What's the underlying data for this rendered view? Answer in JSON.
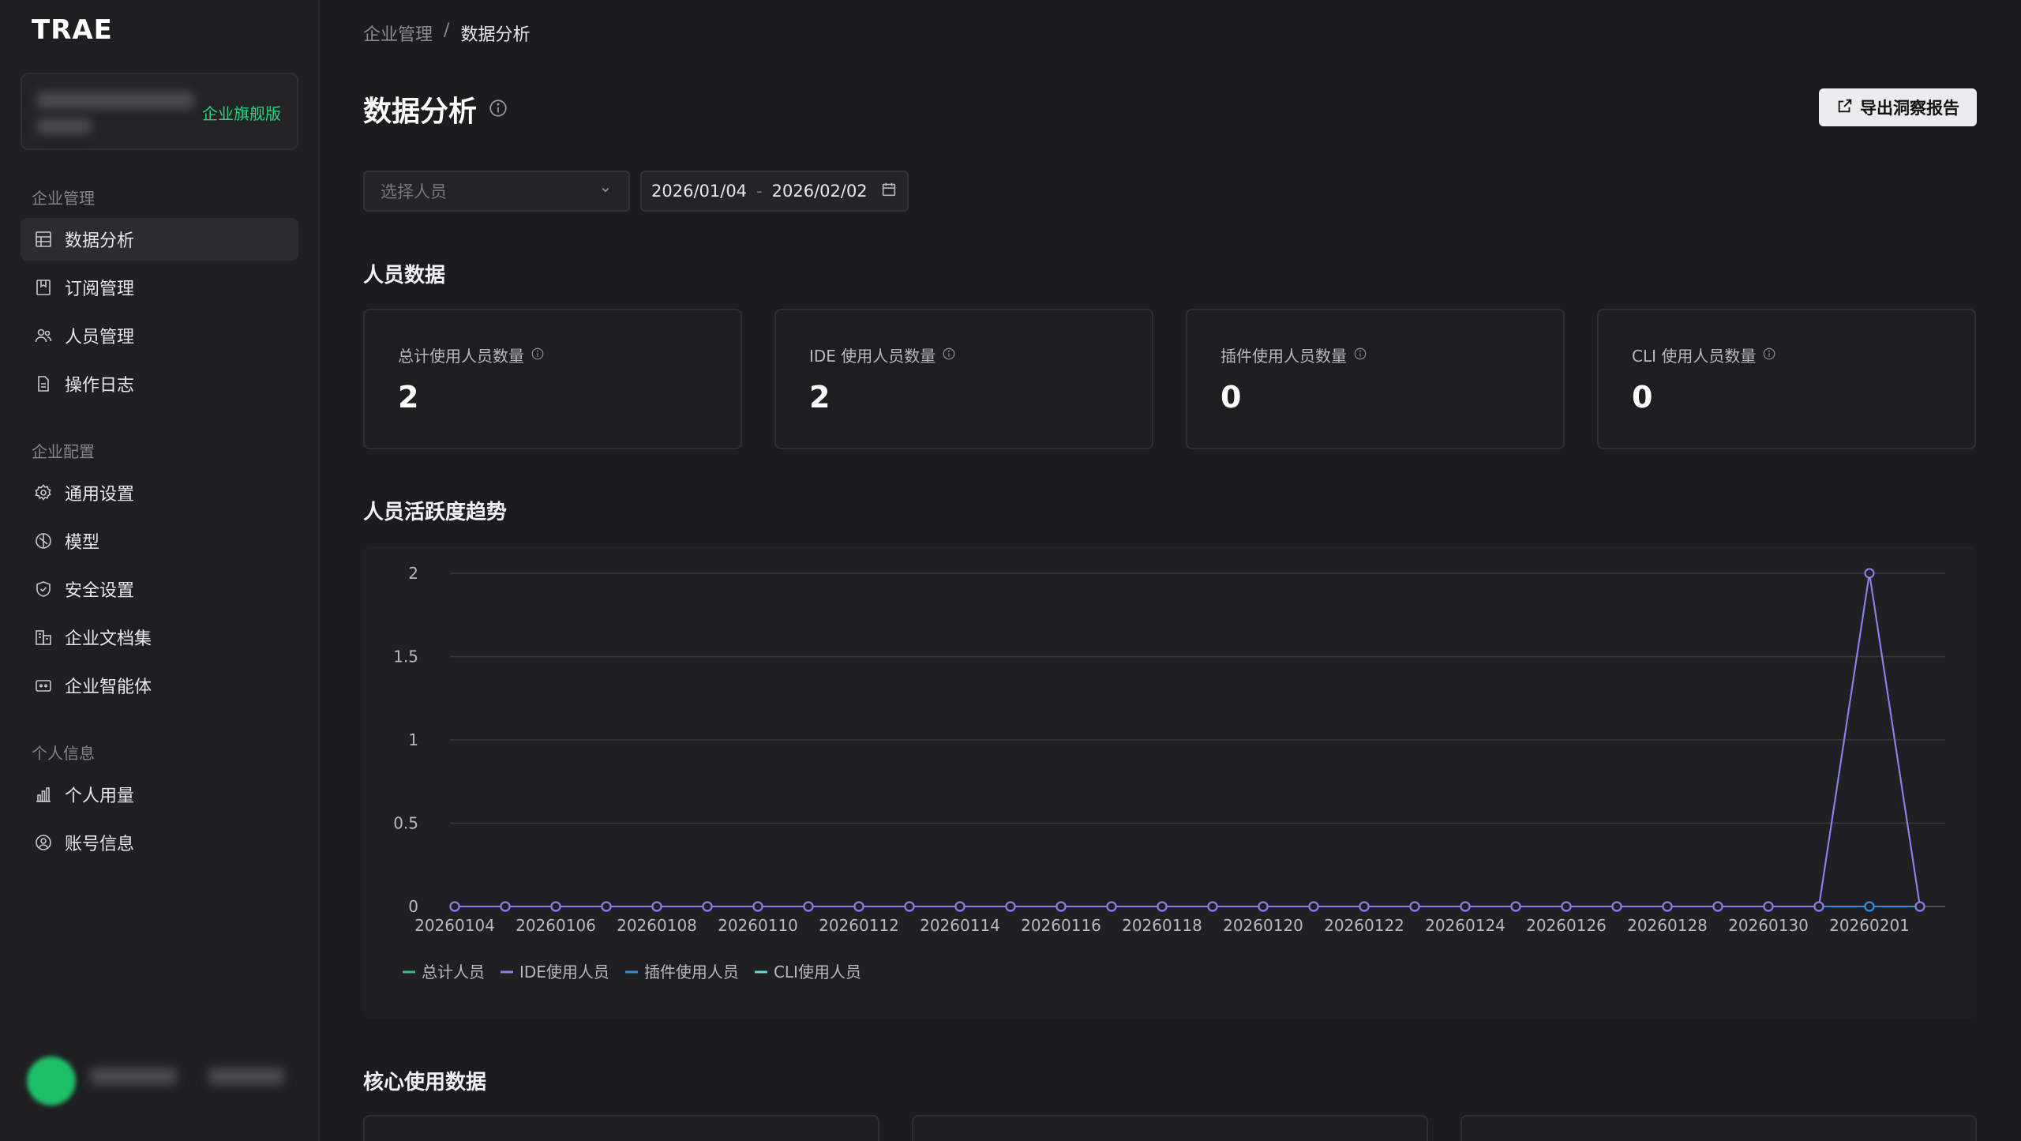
{
  "app": {
    "logo": "TRAE"
  },
  "org": {
    "badge": "企业旗舰版"
  },
  "sidebar": {
    "sections": [
      {
        "label": "企业管理",
        "items": [
          {
            "label": "数据分析",
            "icon": "table-icon",
            "active": true
          },
          {
            "label": "订阅管理",
            "icon": "bookmark-icon"
          },
          {
            "label": "人员管理",
            "icon": "users-icon"
          },
          {
            "label": "操作日志",
            "icon": "file-text-icon"
          }
        ]
      },
      {
        "label": "企业配置",
        "items": [
          {
            "label": "通用设置",
            "icon": "gear-icon"
          },
          {
            "label": "模型",
            "icon": "model-icon"
          },
          {
            "label": "安全设置",
            "icon": "shield-icon"
          },
          {
            "label": "企业文档集",
            "icon": "building-icon"
          },
          {
            "label": "企业智能体",
            "icon": "agent-icon"
          }
        ]
      },
      {
        "label": "个人信息",
        "items": [
          {
            "label": "个人用量",
            "icon": "bar-chart-icon"
          },
          {
            "label": "账号信息",
            "icon": "user-circle-icon"
          }
        ]
      }
    ]
  },
  "breadcrumb": {
    "parent": "企业管理",
    "separator": "/",
    "current": "数据分析"
  },
  "header": {
    "title": "数据分析",
    "export_label": "导出洞察报告"
  },
  "filters": {
    "person_placeholder": "选择人员",
    "date_start": "2026/01/04",
    "date_sep": "-",
    "date_end": "2026/02/02"
  },
  "people_section": {
    "title": "人员数据",
    "stats": [
      {
        "label": "总计使用人员数量",
        "value": "2"
      },
      {
        "label": "IDE 使用人员数量",
        "value": "2"
      },
      {
        "label": "插件使用人员数量",
        "value": "0"
      },
      {
        "label": "CLI 使用人员数量",
        "value": "0"
      }
    ]
  },
  "trend_section": {
    "title": "人员活跃度趋势"
  },
  "core_section": {
    "title": "核心使用数据"
  },
  "colors": {
    "total": "#2ec48a",
    "ide": "#8e7cf0",
    "plugin": "#2f8fe0",
    "cli": "#5fe0d6"
  },
  "chart_data": {
    "type": "line",
    "x": [
      "20260104",
      "20260105",
      "20260106",
      "20260107",
      "20260108",
      "20260109",
      "20260110",
      "20260111",
      "20260112",
      "20260113",
      "20260114",
      "20260115",
      "20260116",
      "20260117",
      "20260118",
      "20260119",
      "20260120",
      "20260121",
      "20260122",
      "20260123",
      "20260124",
      "20260125",
      "20260126",
      "20260127",
      "20260128",
      "20260129",
      "20260130",
      "20260131",
      "20260201",
      "20260202"
    ],
    "xtick_labels": [
      "20260104",
      "20260106",
      "20260108",
      "20260110",
      "20260112",
      "20260114",
      "20260116",
      "20260118",
      "20260120",
      "20260122",
      "20260124",
      "20260126",
      "20260128",
      "20260130",
      "20260201"
    ],
    "yticks": [
      "0",
      "0.5",
      "1",
      "1.5",
      "2"
    ],
    "ylim": [
      0,
      2
    ],
    "grid": true,
    "legend_position": "bottom-left",
    "series": [
      {
        "name": "总计人员",
        "values": [
          0,
          0,
          0,
          0,
          0,
          0,
          0,
          0,
          0,
          0,
          0,
          0,
          0,
          0,
          0,
          0,
          0,
          0,
          0,
          0,
          0,
          0,
          0,
          0,
          0,
          0,
          0,
          0,
          2,
          0
        ]
      },
      {
        "name": "IDE使用人员",
        "values": [
          0,
          0,
          0,
          0,
          0,
          0,
          0,
          0,
          0,
          0,
          0,
          0,
          0,
          0,
          0,
          0,
          0,
          0,
          0,
          0,
          0,
          0,
          0,
          0,
          0,
          0,
          0,
          0,
          2,
          0
        ]
      },
      {
        "name": "插件使用人员",
        "values": [
          0,
          0,
          0,
          0,
          0,
          0,
          0,
          0,
          0,
          0,
          0,
          0,
          0,
          0,
          0,
          0,
          0,
          0,
          0,
          0,
          0,
          0,
          0,
          0,
          0,
          0,
          0,
          0,
          0,
          0
        ]
      },
      {
        "name": "CLI使用人员",
        "values": [
          0,
          0,
          0,
          0,
          0,
          0,
          0,
          0,
          0,
          0,
          0,
          0,
          0,
          0,
          0,
          0,
          0,
          0,
          0,
          0,
          0,
          0,
          0,
          0,
          0,
          0,
          0,
          0,
          0,
          0
        ]
      }
    ]
  }
}
